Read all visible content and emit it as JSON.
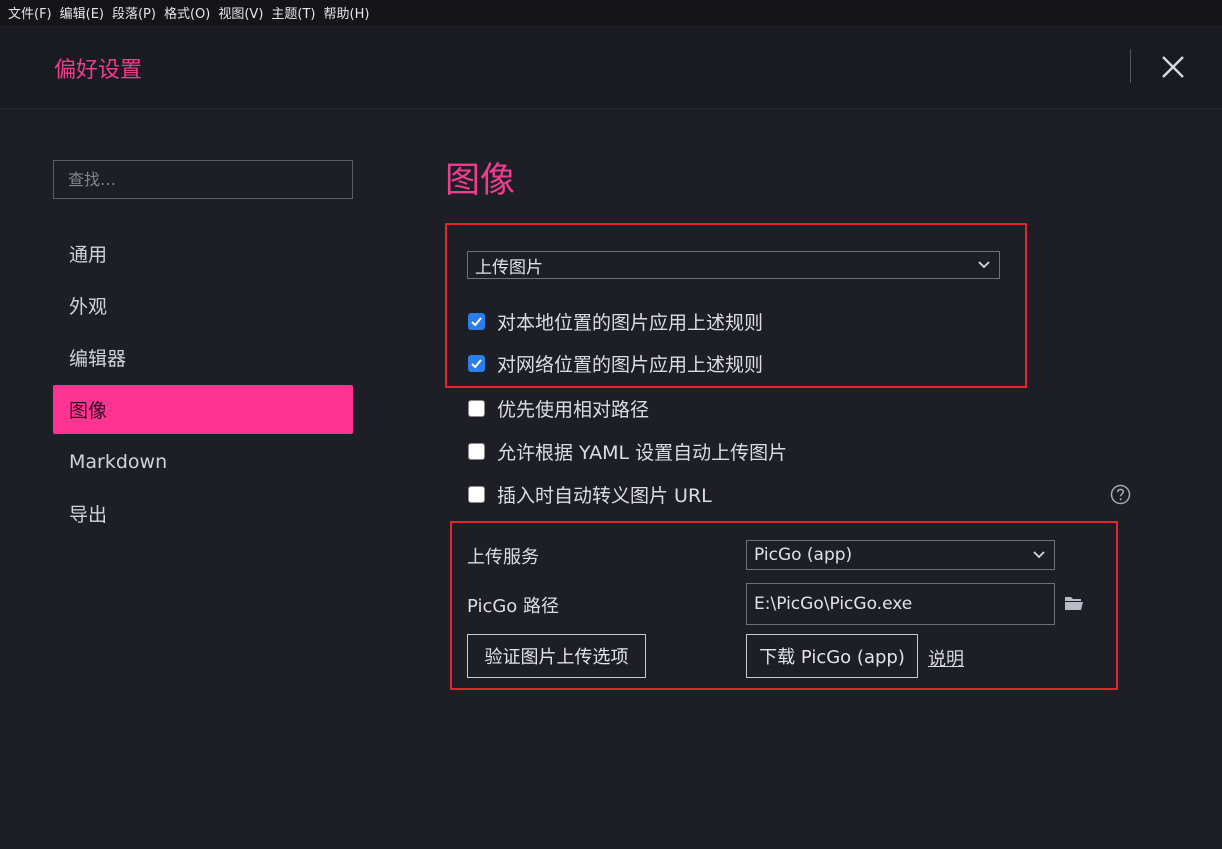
{
  "menubar": {
    "items": [
      "文件(F)",
      "编辑(E)",
      "段落(P)",
      "格式(O)",
      "视图(V)",
      "主题(T)",
      "帮助(H)"
    ]
  },
  "dialog": {
    "title": "偏好设置"
  },
  "sidebar": {
    "search_placeholder": "查找…",
    "items": [
      {
        "label": "通用",
        "active": false
      },
      {
        "label": "外观",
        "active": false
      },
      {
        "label": "编辑器",
        "active": false
      },
      {
        "label": "图像",
        "active": true
      },
      {
        "label": "Markdown",
        "active": false
      },
      {
        "label": "导出",
        "active": false
      }
    ]
  },
  "main": {
    "section_title": "图像",
    "insert_action": {
      "selected": "上传图片"
    },
    "checkboxes": [
      {
        "label": "对本地位置的图片应用上述规则",
        "checked": true
      },
      {
        "label": "对网络位置的图片应用上述规则",
        "checked": true
      },
      {
        "label": "优先使用相对路径",
        "checked": false
      },
      {
        "label": "允许根据 YAML 设置自动上传图片",
        "checked": false
      },
      {
        "label": "插入时自动转义图片 URL",
        "checked": false
      }
    ],
    "upload": {
      "service_label": "上传服务",
      "service_value": "PicGo (app)",
      "path_label": "PicGo 路径",
      "path_value": "E:\\PicGo\\PicGo.exe",
      "verify_button": "验证图片上传选项",
      "download_button": "下载 PicGo (app)",
      "help_link": "说明"
    }
  },
  "colors": {
    "accent": "#ff3392",
    "title_pink": "#ef3d8d",
    "highlight_red": "#e5242d",
    "checkbox_blue": "#2b7de9",
    "background": "#1e1f26"
  },
  "icons": [
    "close-icon",
    "chevron-down-icon",
    "check-icon",
    "help-icon",
    "folder-icon"
  ]
}
